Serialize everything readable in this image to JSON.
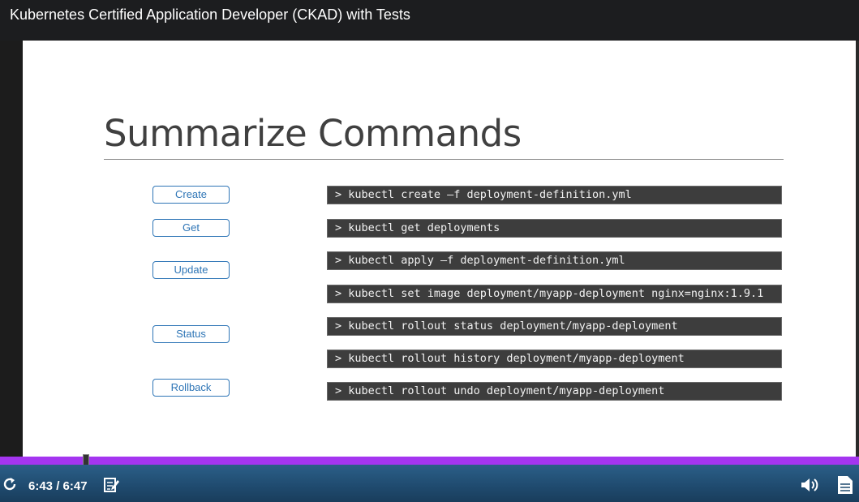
{
  "window": {
    "title": "Kubernetes Certified Application Developer (CKAD) with Tests"
  },
  "slide": {
    "title": "Summarize Commands",
    "labels": [
      "Create",
      "Get",
      "Update",
      "Status",
      "Rollback"
    ],
    "commands": [
      "> kubectl create –f deployment-definition.yml",
      "> kubectl get deployments",
      "> kubectl apply –f deployment-definition.yml",
      "> kubectl set image deployment/myapp-deployment nginx=nginx:1.9.1",
      "> kubectl rollout status deployment/myapp-deployment",
      "> kubectl rollout history deployment/myapp-deployment",
      "> kubectl rollout undo deployment/myapp-deployment"
    ]
  },
  "player": {
    "time": "6:43 / 6:47",
    "progress_fraction": 1.0,
    "icons": [
      "replay-icon",
      "notes-icon",
      "volume-icon",
      "transcript-icon"
    ],
    "accent": "#a435f0"
  }
}
